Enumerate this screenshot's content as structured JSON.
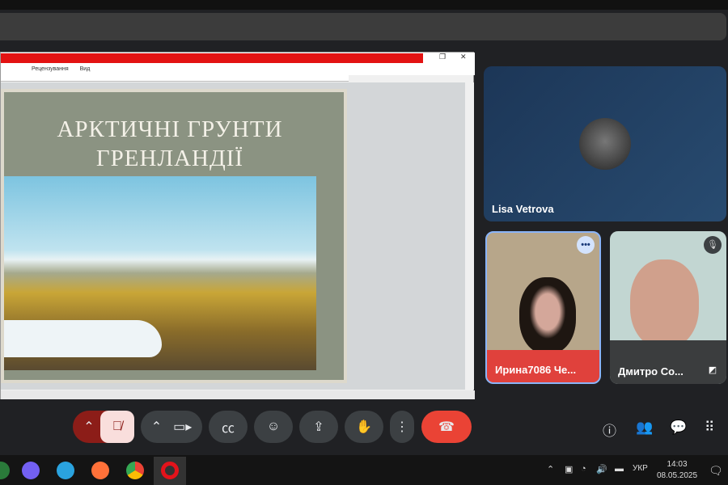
{
  "powerpoint": {
    "menu": [
      "Рецензування",
      "Вид"
    ],
    "restore_icon": "restore-icon",
    "close_label": "✕",
    "slide_title_line1": "АРКТИЧНІ ГРУНТИ",
    "slide_title_line2": "ГРЕНЛАНДІЇ"
  },
  "participants": [
    {
      "name": "Lisa Vetrova"
    },
    {
      "name": "Ирина7086 Че..."
    },
    {
      "name": "Дмитро Со..."
    }
  ],
  "colors": {
    "end_call": "#ea4335",
    "mic_off": "#f9dedc",
    "active_border": "#8ab4f8",
    "tile_bg": "#3c4043"
  },
  "controls": [
    "chevron-up",
    "mic-off",
    "chevron-up",
    "camera",
    "captions",
    "emoji",
    "present",
    "raise-hand",
    "more",
    "end-call"
  ],
  "side_controls": [
    "info",
    "people",
    "chat",
    "activities"
  ],
  "taskbar": {
    "apps": [
      "viber",
      "telegram",
      "firefox",
      "chrome",
      "opera"
    ],
    "language": "УКР",
    "time": "14:03",
    "date": "08.05.2025"
  }
}
